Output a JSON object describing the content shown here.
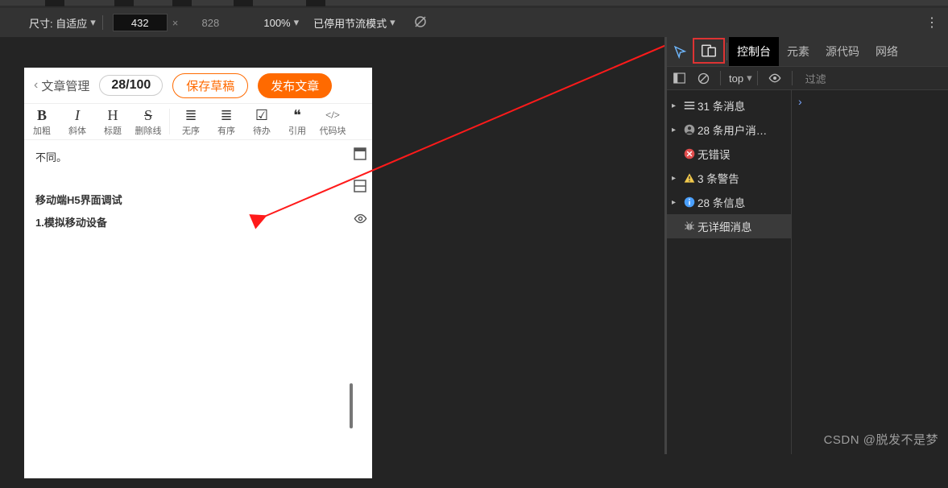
{
  "device_toolbar": {
    "size_label": "尺寸: 自适应",
    "width": "432",
    "height": "828",
    "zoom": "100%",
    "throttle": "已停用节流模式"
  },
  "editor": {
    "back": "文章管理",
    "count": "28/100",
    "save_draft": "保存草稿",
    "publish": "发布文章",
    "format": {
      "bold": {
        "icon": "B",
        "label": "加粗"
      },
      "italic": {
        "icon": "I",
        "label": "斜体"
      },
      "heading": {
        "icon": "H",
        "label": "标题"
      },
      "strike": {
        "icon": "S",
        "label": "删除线"
      },
      "ul": {
        "icon": "≣",
        "label": "无序"
      },
      "ol": {
        "icon": "≣",
        "label": "有序"
      },
      "todo": {
        "icon": "☑",
        "label": "待办"
      },
      "quote": {
        "icon": "❝",
        "label": "引用"
      },
      "code": {
        "icon": "</>",
        "label": "代码块"
      }
    },
    "body": {
      "line1": "不同。",
      "line2": "移动端H5界面调试",
      "line3": "1.模拟移动设备"
    }
  },
  "devtools": {
    "tabs": {
      "console": "控制台",
      "elements": "元素",
      "sources": "源代码",
      "network": "网络"
    },
    "filter": {
      "context": "top",
      "placeholder": "过滤"
    },
    "sidebar": [
      {
        "tri": "▸",
        "icon": "list",
        "text": "31 条消息"
      },
      {
        "tri": "▸",
        "icon": "user",
        "text": "28 条用户消…"
      },
      {
        "tri": "",
        "icon": "err",
        "text": "无错误"
      },
      {
        "tri": "▸",
        "icon": "warn",
        "text": "3 条警告"
      },
      {
        "tri": "▸",
        "icon": "info",
        "text": "28 条信息"
      },
      {
        "tri": "",
        "icon": "bug",
        "text": "无详细消息",
        "sel": true
      }
    ],
    "prompt": "›"
  },
  "watermark": "CSDN @脱发不是梦"
}
